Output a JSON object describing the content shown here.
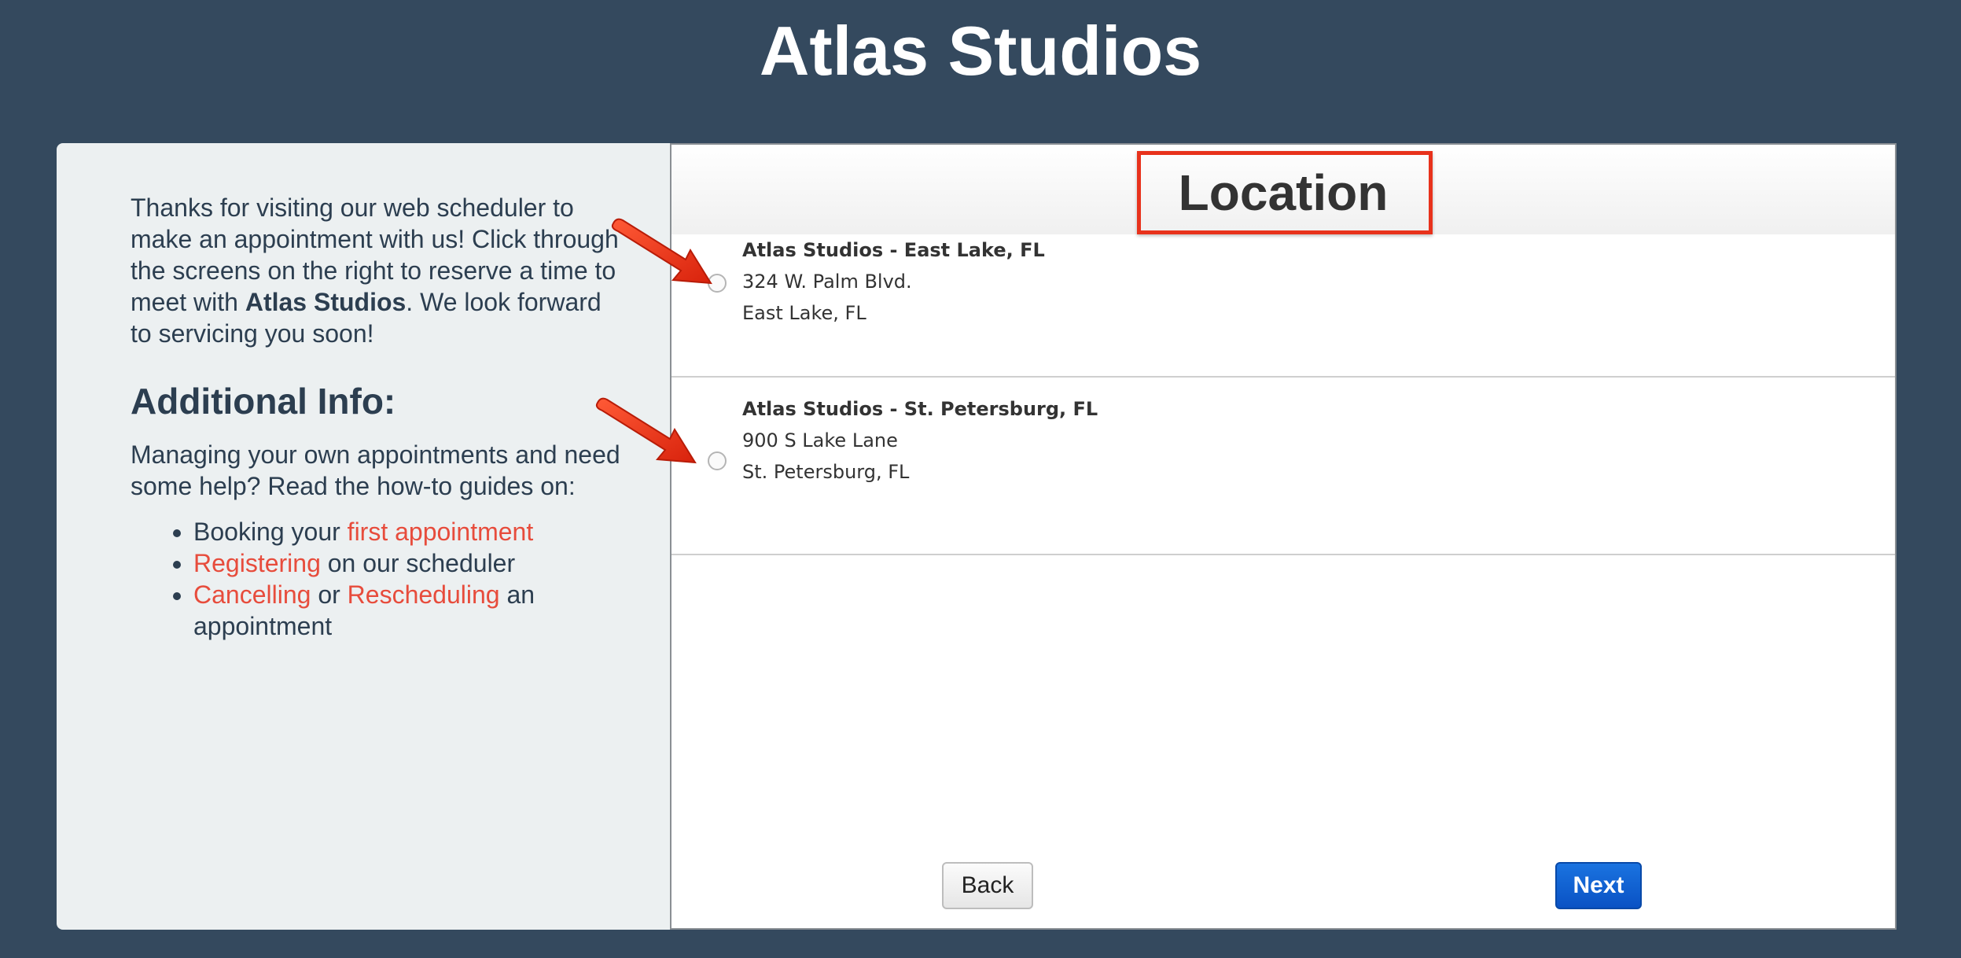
{
  "site": {
    "title": "Atlas Studios"
  },
  "info_panel": {
    "intro_before_bold": "Thanks for visiting our web scheduler to make an appointment with us! Click through the screens on the right to reserve a time to meet with ",
    "intro_bold": "Atlas Studios",
    "intro_after_bold": ". We look forward to servicing you soon!",
    "heading": "Additional Info:",
    "help_text": "Managing your own appointments and need some help? Read the how-to guides on:",
    "guides": [
      {
        "prefix": "Booking your ",
        "link": "first appointment",
        "suffix": ""
      },
      {
        "prefix": "",
        "link": "Registering",
        "suffix": " on our scheduler"
      },
      {
        "prefix": "",
        "link": "Cancelling",
        "middle": " or ",
        "link2": "Rescheduling",
        "suffix": " an appointment"
      }
    ],
    "link_color": "#e74c3c"
  },
  "form": {
    "title": "Location",
    "locations": [
      {
        "name": "Atlas Studios - East Lake, FL",
        "address": "324 W. Palm Blvd.",
        "city": "East Lake, FL",
        "selected": false
      },
      {
        "name": "Atlas Studios - St. Petersburg, FL",
        "address": "900 S Lake Lane",
        "city": "St. Petersburg, FL",
        "selected": false
      }
    ],
    "back_label": "Back",
    "next_label": "Next"
  },
  "colors": {
    "background": "#34495e",
    "annotation_red": "#e8321c",
    "next_button": "#0a52c4"
  }
}
